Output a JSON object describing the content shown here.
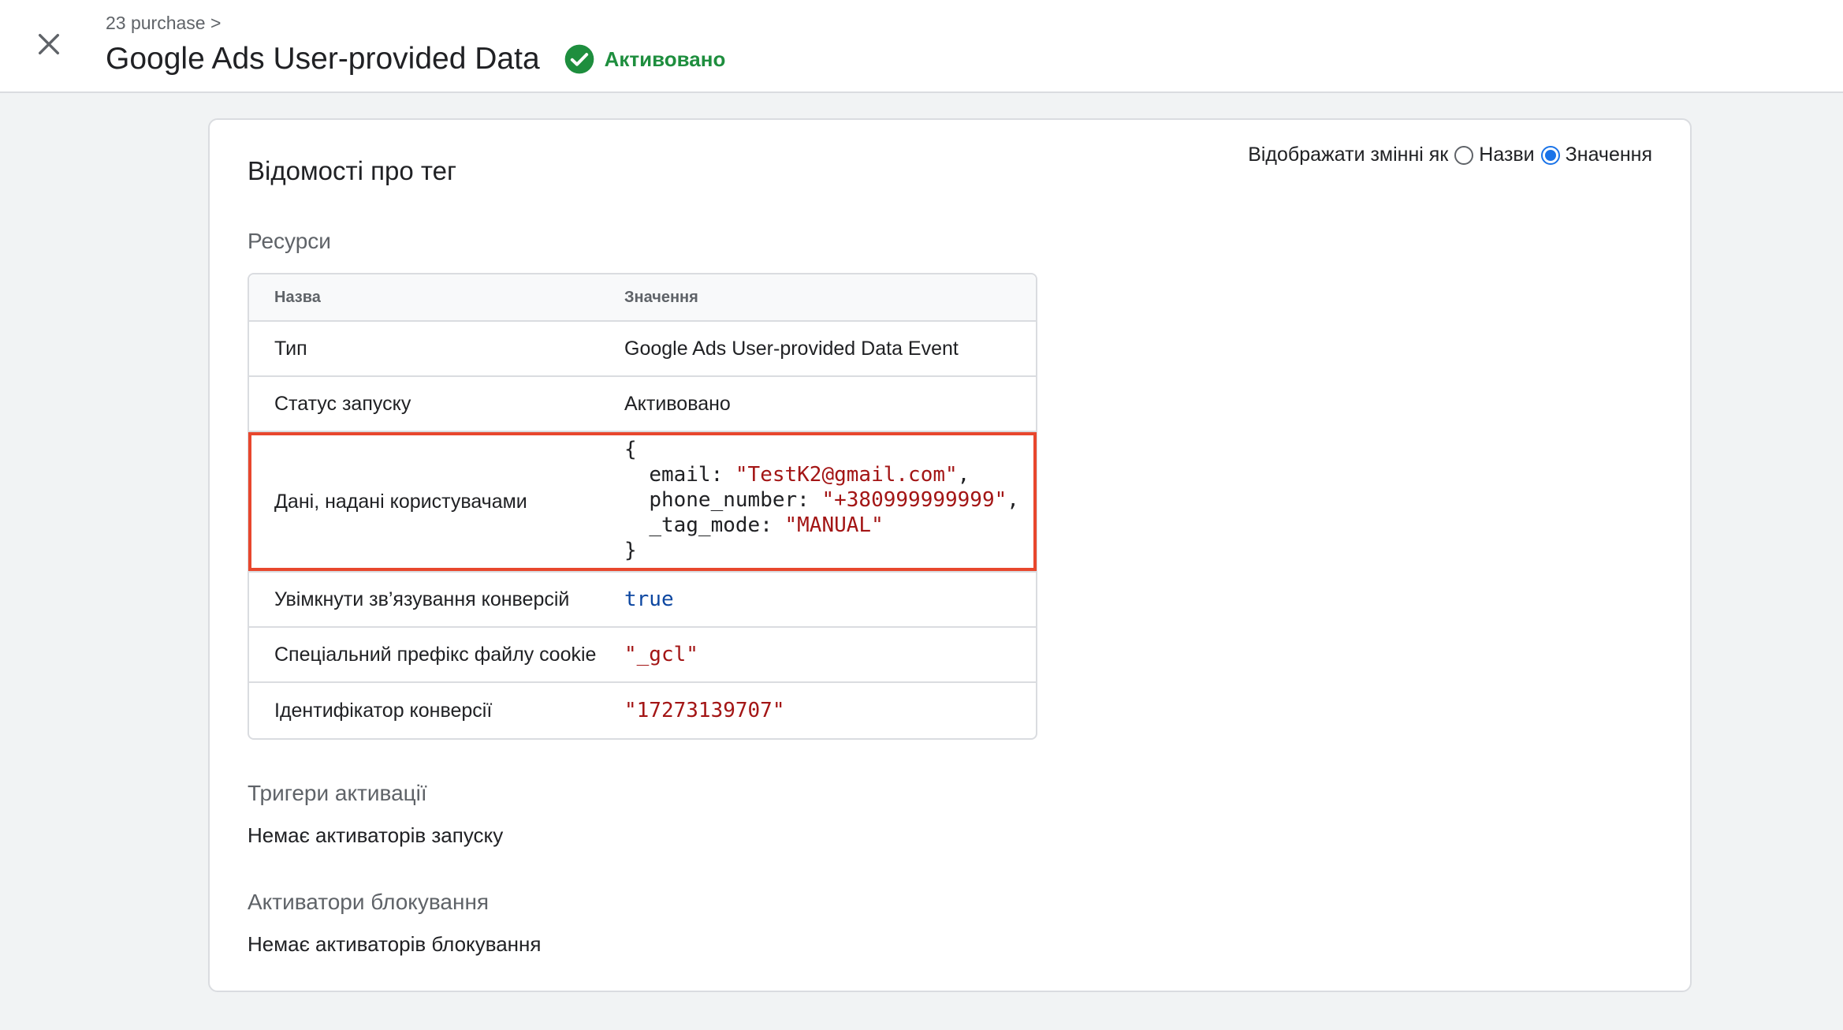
{
  "header": {
    "breadcrumb": "23 purchase >",
    "title": "Google Ads User-provided Data",
    "status": "Активовано",
    "close_icon": "close-icon",
    "status_icon": "check-circle-icon"
  },
  "card": {
    "title": "Відомості про тег",
    "display_toggle": {
      "label": "Відображати змінні як",
      "options": [
        "Назви",
        "Значення"
      ],
      "selected": "Значення"
    },
    "resources": {
      "title": "Ресурси",
      "columns": [
        "Назва",
        "Значення"
      ],
      "rows": [
        {
          "name": "Тип",
          "value": "Google Ads User-provided Data Event"
        },
        {
          "name": "Статус запуску",
          "value": "Активовано"
        },
        {
          "name": "Дані, надані користувачами",
          "json": {
            "open": "{",
            "lines": [
              {
                "key": "email: ",
                "val": "\"TestK2@gmail.com\"",
                "end": ","
              },
              {
                "key": "phone_number: ",
                "val": "\"+380999999999\"",
                "end": ","
              },
              {
                "key": "_tag_mode: ",
                "val": "\"MANUAL\"",
                "end": ""
              }
            ],
            "close": "}"
          }
        },
        {
          "name": "Увімкнути зв’язування конверсій",
          "value": "true"
        },
        {
          "name": "Спеціальний префікс файлу cookie",
          "value": "\"_gcl\""
        },
        {
          "name": "Ідентифікатор конверсії",
          "value": "\"17273139707\""
        }
      ]
    },
    "triggers": {
      "title": "Тригери активації",
      "text": "Немає активаторів запуску"
    },
    "blocking": {
      "title": "Активатори блокування",
      "text": "Немає активаторів блокування"
    }
  },
  "colors": {
    "accent": "#1a73e8",
    "status_green": "#1e8e3e",
    "highlight_border": "#e8472d",
    "string_value": "#a31515"
  }
}
